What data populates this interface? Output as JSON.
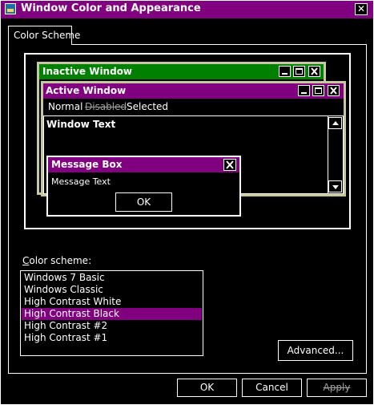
{
  "window": {
    "title": "Window Color and Appearance",
    "close_glyph": "✕"
  },
  "tabs": [
    {
      "label": "Color Scheme",
      "active": true
    }
  ],
  "preview": {
    "inactive_window_title": "Inactive Window",
    "active_window_title": "Active Window",
    "menu": [
      "Normal",
      "Disabled",
      "Selected"
    ],
    "window_text": "Window Text",
    "message_box": {
      "title": "Message Box",
      "text": "Message Text",
      "ok_label": "OK"
    },
    "caption_buttons": [
      "minimize-icon",
      "maximize-icon",
      "close-icon"
    ]
  },
  "color_scheme": {
    "label": "Color scheme:",
    "items": [
      "Windows 7 Basic",
      "Windows Classic",
      "High Contrast White",
      "High Contrast Black",
      "High Contrast #2",
      "High Contrast #1"
    ],
    "selected_index": 3
  },
  "buttons": {
    "advanced": "Advanced...",
    "ok": "OK",
    "cancel": "Cancel",
    "apply": "Apply"
  },
  "colors": {
    "background": "#000000",
    "foreground": "#ffffff",
    "active_title": "#800080",
    "inactive_title": "#008000",
    "selection": "#800080",
    "disabled_text": "#a0a0a0",
    "window_border": "#c8c8a0"
  }
}
